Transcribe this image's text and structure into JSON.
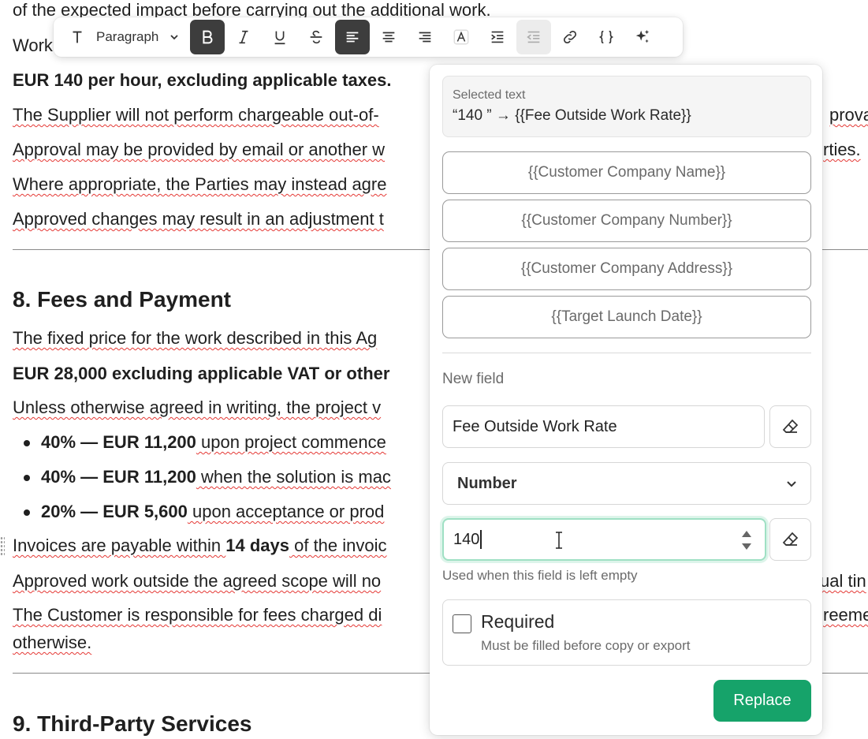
{
  "document": {
    "line0": "of the expected impact before carrying out the additional work.",
    "line1_start": "Work",
    "rate_line": "EUR 140 per hour, excluding applicable taxes.",
    "para_supplier": "The Supplier will not perform chargeable out-of-",
    "para_supplier_tail": "prova",
    "para_approval": "Approval may be provided by email or another w",
    "para_approval_tail": "rties.",
    "para_where": "Where appropriate, the Parties may instead agre",
    "para_approved": "Approved changes may result in an adjustment t",
    "heading_8": "8. Fees and Payment",
    "para_fixed": "The fixed price for the work described in this Ag",
    "price_line": "EUR 28,000 excluding applicable VAT or other",
    "para_unless": "Unless otherwise agreed in writing, the project v",
    "bullets": [
      {
        "bold": "40% — EUR 11,200",
        "text": " upon project commence"
      },
      {
        "bold": "40% — EUR 11,200",
        "text": " when the solution is mac"
      },
      {
        "bold": "20% — EUR 5,600",
        "text": " upon acceptance or prod"
      }
    ],
    "invoices_a": "Invoices are payable within ",
    "invoices_b": "14 days",
    "invoices_c": " of the invoic",
    "para_outside": "Approved work outside the agreed scope will no",
    "para_outside_tail": "ual tin",
    "para_customer": "The Customer is responsible for fees charged di",
    "para_customer_tail": "reeme",
    "para_otherwise": "otherwise.",
    "heading_9": "9. Third-Party Services"
  },
  "toolbar": {
    "paragraph_label": "Paragraph",
    "icons": [
      "text-type-icon",
      "bold-icon",
      "italic-icon",
      "underline-icon",
      "strikethrough-icon",
      "align-left-icon",
      "align-center-icon",
      "align-right-icon",
      "text-color-icon",
      "indent-icon",
      "outdent-icon",
      "link-icon",
      "braces-icon",
      "sparkle-icon"
    ]
  },
  "panel": {
    "selected_label": "Selected text",
    "selected_value": "“140 ” → {{Fee Outside Work Rate}}",
    "fields": [
      "{{Customer Company Name}}",
      "{{Customer Company Number}}",
      "{{Customer Company Address}}",
      "{{Target Launch Date}}"
    ],
    "new_field_label": "New field",
    "name_value": "Fee Outside Work Rate",
    "type_value": "Number",
    "default_value": "140",
    "hint": "Used when this field is left empty",
    "required_label": "Required",
    "required_sub": "Must be filled before copy or export",
    "replace_label": "Replace"
  },
  "colors": {
    "accent": "#16a36a",
    "focus": "#9fe0c4",
    "active_tool": "#3d3d3d",
    "spell_error": "#e53935"
  }
}
